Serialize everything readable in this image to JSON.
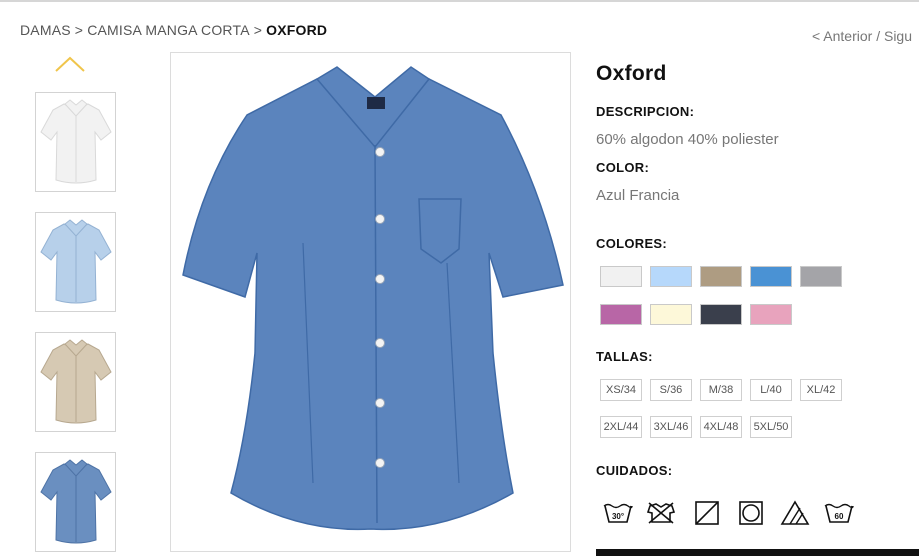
{
  "breadcrumb": {
    "items": [
      "DAMAS",
      "CAMISA MANGA CORTA"
    ],
    "separator": ">",
    "current": "OXFORD"
  },
  "pager": {
    "label": "< Anterior / Sigu"
  },
  "gallery": {
    "up_arrow_color": "#f0c54b",
    "thumbnails": [
      {
        "color": "#f2f2f2",
        "shade": "#d9d9d9"
      },
      {
        "color": "#b7d0ea",
        "shade": "#94b2d3"
      },
      {
        "color": "#d6c9b3",
        "shade": "#b7a88f"
      },
      {
        "color": "#6a8fc0",
        "shade": "#4e73a6"
      }
    ],
    "main_color": "#5b84bd",
    "main_shade": "#3f6aa6",
    "main_logo": "logo"
  },
  "product": {
    "title": "Oxford",
    "descripcion_label": "DESCRIPCION:",
    "descripcion_value": "60% algodon 40% poliester",
    "color_label": "COLOR:",
    "color_value": "Azul Francia",
    "colores_label": "COLORES:",
    "colores": [
      "#f1f1f1",
      "#b6d8fb",
      "#ae9c82",
      "#4a92d4",
      "#a4a4a8",
      "#b866a6",
      "#fdf8d9",
      "#3a3f4c",
      "#e8a3bd"
    ],
    "tallas_label": "TALLAS:",
    "tallas": [
      "XS/34",
      "S/36",
      "M/38",
      "L/40",
      "XL/42",
      "2XL/44",
      "3XL/46",
      "4XL/48",
      "5XL/50"
    ],
    "cuidados_label": "CUIDADOS:",
    "cuidados": [
      "wash-30-icon",
      "no-tumble-dry-icon",
      "dry-flat-icon",
      "tumble-dry-icon",
      "bleach-icon",
      "wash-60-icon"
    ],
    "wash_30": "30°",
    "wash_60": "60"
  }
}
